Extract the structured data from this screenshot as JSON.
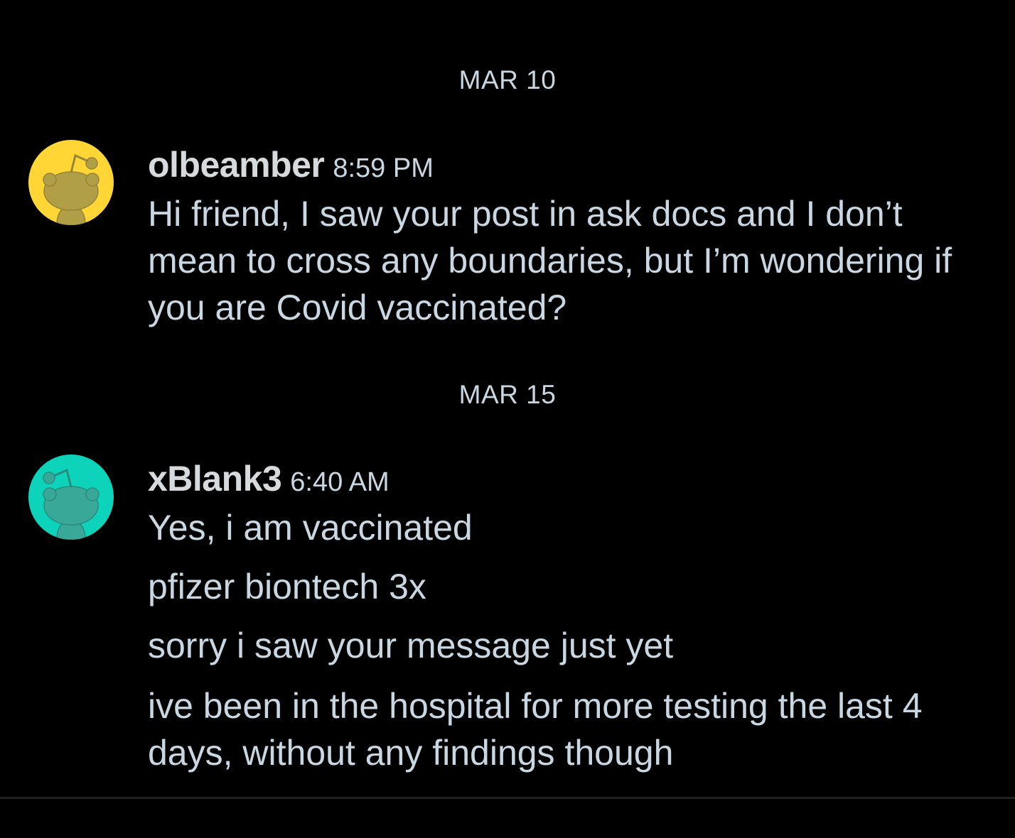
{
  "conversation": {
    "groups": [
      {
        "date": "MAR 10",
        "username": "olbeamber",
        "time": "8:59 PM",
        "avatar_color": "#FFD635",
        "messages": [
          "Hi friend, I saw your post in ask docs and I don’t mean to cross any boundaries, but I’m wondering if you are Covid vaccinated?"
        ]
      },
      {
        "date": "MAR 15",
        "username": "xBlank3",
        "time": "6:40 AM",
        "avatar_color": "#0DD3BB",
        "messages": [
          "Yes, i am vaccinated",
          "pfizer biontech 3x",
          "sorry i saw your message just yet",
          "ive been in the hospital for more testing the last 4 days, without any findings though"
        ]
      }
    ]
  },
  "icons": {
    "avatar": "snoo-avatar-icon"
  }
}
